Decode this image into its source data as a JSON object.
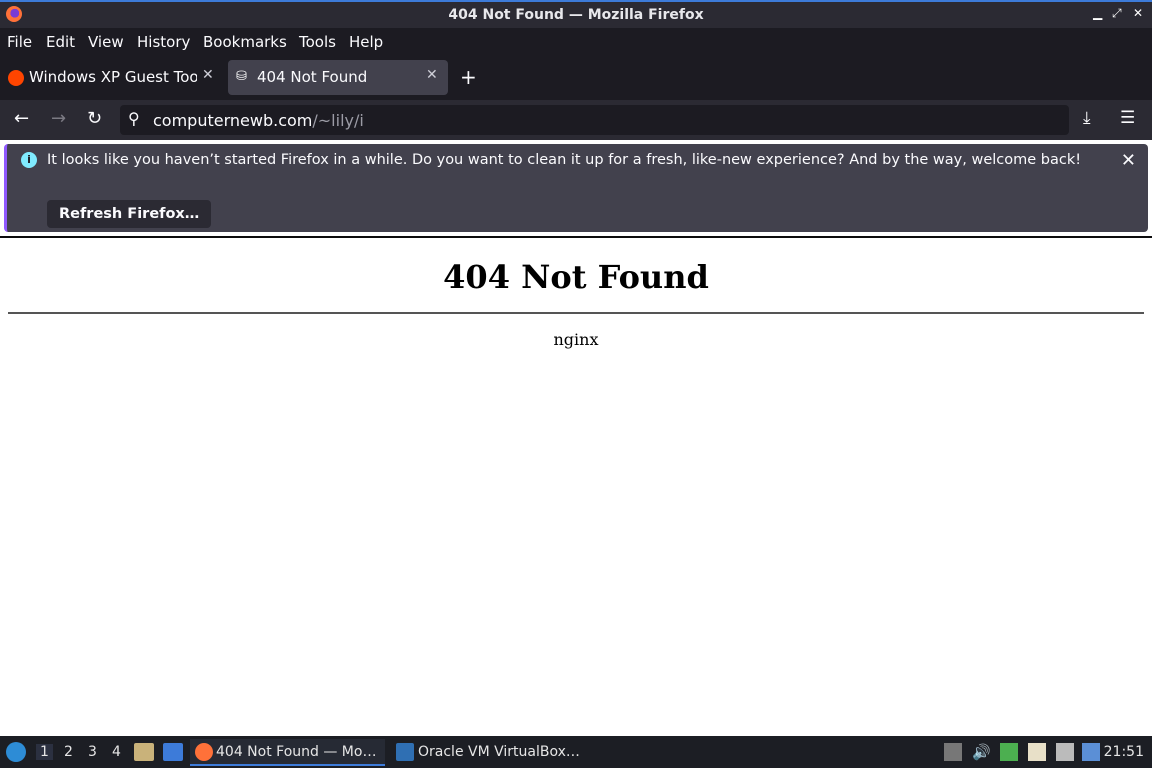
{
  "window": {
    "title": "404 Not Found — Mozilla Firefox"
  },
  "menu": [
    "File",
    "Edit",
    "View",
    "History",
    "Bookmarks",
    "Tools",
    "Help"
  ],
  "tabs": [
    {
      "label": "Windows XP Guest Too"
    },
    {
      "label": "404 Not Found"
    }
  ],
  "urlbar": {
    "host": "computernewb.com",
    "path": "/~lily/i"
  },
  "notification": {
    "message": "It looks like you haven’t started Firefox in a while. Do you want to clean it up for a fresh, like-new experience? And by the way, welcome back!",
    "button": "Refresh Firefox…"
  },
  "page": {
    "heading": "404 Not Found",
    "server": "nginx"
  },
  "taskbar": {
    "workspaces": [
      "1",
      "2",
      "3",
      "4"
    ],
    "tasks": [
      {
        "label": "404 Not Found — Mo…"
      },
      {
        "label": "Oracle VM VirtualBox…"
      }
    ],
    "clock": "21:51"
  },
  "colors": {
    "accent": "#3d7bd9",
    "firefox_purple": "#9059ff",
    "info": "#80ebff"
  }
}
